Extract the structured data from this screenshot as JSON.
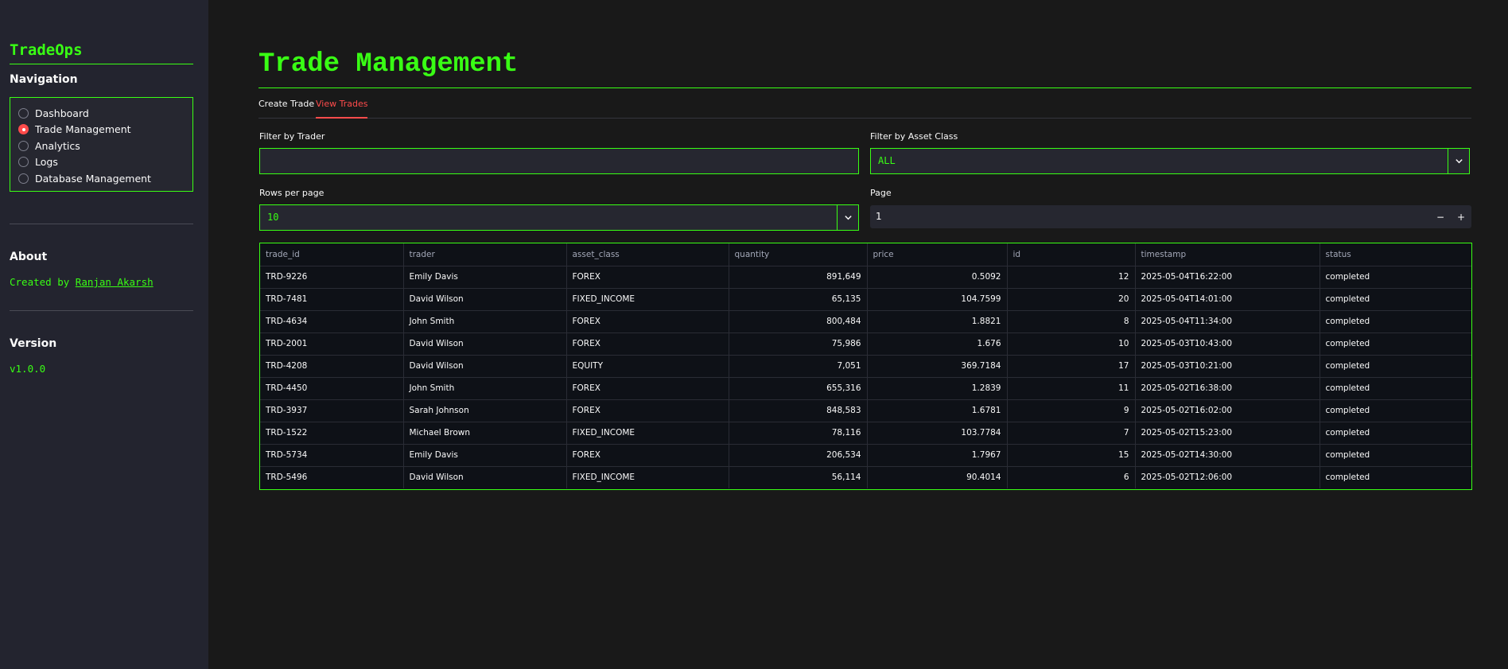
{
  "sidebar": {
    "brand": "TradeOps",
    "nav_title": "Navigation",
    "nav_items": [
      {
        "label": "Dashboard",
        "selected": false
      },
      {
        "label": "Trade Management",
        "selected": true
      },
      {
        "label": "Analytics",
        "selected": false
      },
      {
        "label": "Logs",
        "selected": false
      },
      {
        "label": "Database Management",
        "selected": false
      }
    ],
    "about_title": "About",
    "about_prefix": "Created by",
    "about_author": "Ranjan Akarsh",
    "version_title": "Version",
    "version_value": "v1.0.0"
  },
  "main": {
    "title": "Trade Management",
    "tabs": [
      {
        "label": "Create Trade",
        "active": false
      },
      {
        "label": "View Trades",
        "active": true
      }
    ],
    "filter_trader": {
      "label": "Filter by Trader",
      "value": ""
    },
    "filter_asset": {
      "label": "Filter by Asset Class",
      "value": "ALL"
    },
    "rows_per_page": {
      "label": "Rows per page",
      "value": "10"
    },
    "page": {
      "label": "Page",
      "value": "1",
      "minus": "−",
      "plus": "+"
    }
  },
  "table": {
    "columns": [
      "trade_id",
      "trader",
      "asset_class",
      "quantity",
      "price",
      "id",
      "timestamp",
      "status"
    ],
    "rows": [
      [
        "TRD-9226",
        "Emily Davis",
        "FOREX",
        "891,649",
        "0.5092",
        "12",
        "2025-05-04T16:22:00",
        "completed"
      ],
      [
        "TRD-7481",
        "David Wilson",
        "FIXED_INCOME",
        "65,135",
        "104.7599",
        "20",
        "2025-05-04T14:01:00",
        "completed"
      ],
      [
        "TRD-4634",
        "John Smith",
        "FOREX",
        "800,484",
        "1.8821",
        "8",
        "2025-05-04T11:34:00",
        "completed"
      ],
      [
        "TRD-2001",
        "David Wilson",
        "FOREX",
        "75,986",
        "1.676",
        "10",
        "2025-05-03T10:43:00",
        "completed"
      ],
      [
        "TRD-4208",
        "David Wilson",
        "EQUITY",
        "7,051",
        "369.7184",
        "17",
        "2025-05-03T10:21:00",
        "completed"
      ],
      [
        "TRD-4450",
        "John Smith",
        "FOREX",
        "655,316",
        "1.2839",
        "11",
        "2025-05-02T16:38:00",
        "completed"
      ],
      [
        "TRD-3937",
        "Sarah Johnson",
        "FOREX",
        "848,583",
        "1.6781",
        "9",
        "2025-05-02T16:02:00",
        "completed"
      ],
      [
        "TRD-1522",
        "Michael Brown",
        "FIXED_INCOME",
        "78,116",
        "103.7784",
        "7",
        "2025-05-02T15:23:00",
        "completed"
      ],
      [
        "TRD-5734",
        "Emily Davis",
        "FOREX",
        "206,534",
        "1.7967",
        "15",
        "2025-05-02T14:30:00",
        "completed"
      ],
      [
        "TRD-5496",
        "David Wilson",
        "FIXED_INCOME",
        "56,114",
        "90.4014",
        "6",
        "2025-05-02T12:06:00",
        "completed"
      ]
    ]
  },
  "colors": {
    "accent": "#39ff14",
    "active_tab": "#ff4b4b",
    "background": "#191919",
    "sidebar": "#23242f"
  }
}
